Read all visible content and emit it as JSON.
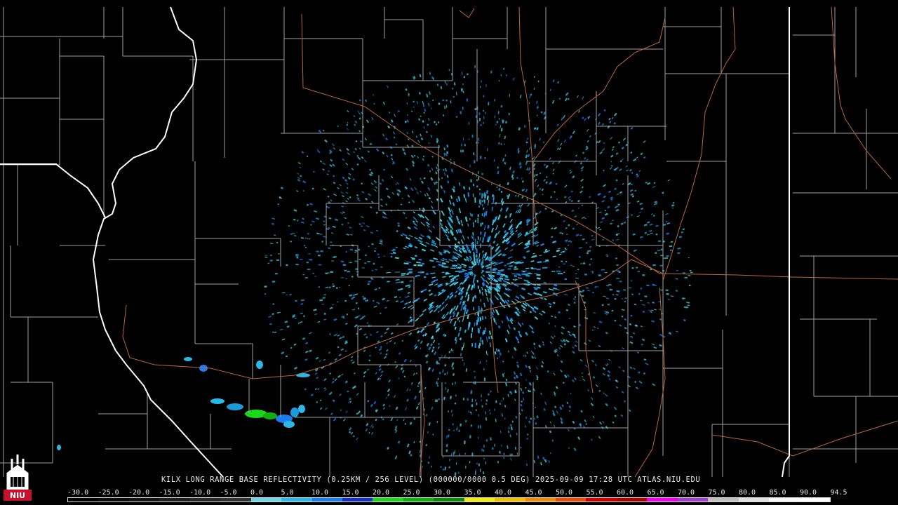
{
  "product_caption": "KILX LONG RANGE BASE REFLECTIVITY (0.25KM / 256 LEVEL) (000000/0000 0.5 DEG) 2025-09-09 17:28 UTC  ATLAS.NIU.EDU",
  "logo_text": "NIU",
  "scale": {
    "labels": [
      "-30.0",
      "-25.0",
      "-20.0",
      "-15.0",
      "-10.0",
      "-5.0",
      "0.0",
      "5.0",
      "10.0",
      "15.0",
      "20.0",
      "25.0",
      "30.0",
      "35.0",
      "40.0",
      "45.0",
      "50.0",
      "55.0",
      "60.0",
      "65.0",
      "70.0",
      "75.0",
      "80.0",
      "85.0",
      "90.0",
      "94.5"
    ],
    "colors": [
      "#000000",
      "#0a0a0a",
      "#141414",
      "#1e1e1e",
      "#282828",
      "#323232",
      "#6ad8e8",
      "#2ab8e6",
      "#1a7ef0",
      "#1530d0",
      "#18d818",
      "#10b010",
      "#0a8a0a",
      "#f0f000",
      "#f0c000",
      "#f08c00",
      "#f04800",
      "#d00000",
      "#b00000",
      "#f000f0",
      "#a040c8",
      "#c0c0c0",
      "#e0e0e0",
      "#f8f8f8",
      "#ffffff"
    ]
  },
  "colors": {
    "background": "#000000",
    "county_lines": "#a8a8a8",
    "state_lines": "#ffffff",
    "roads": "#b86838",
    "logo_red": "#c8102e"
  }
}
